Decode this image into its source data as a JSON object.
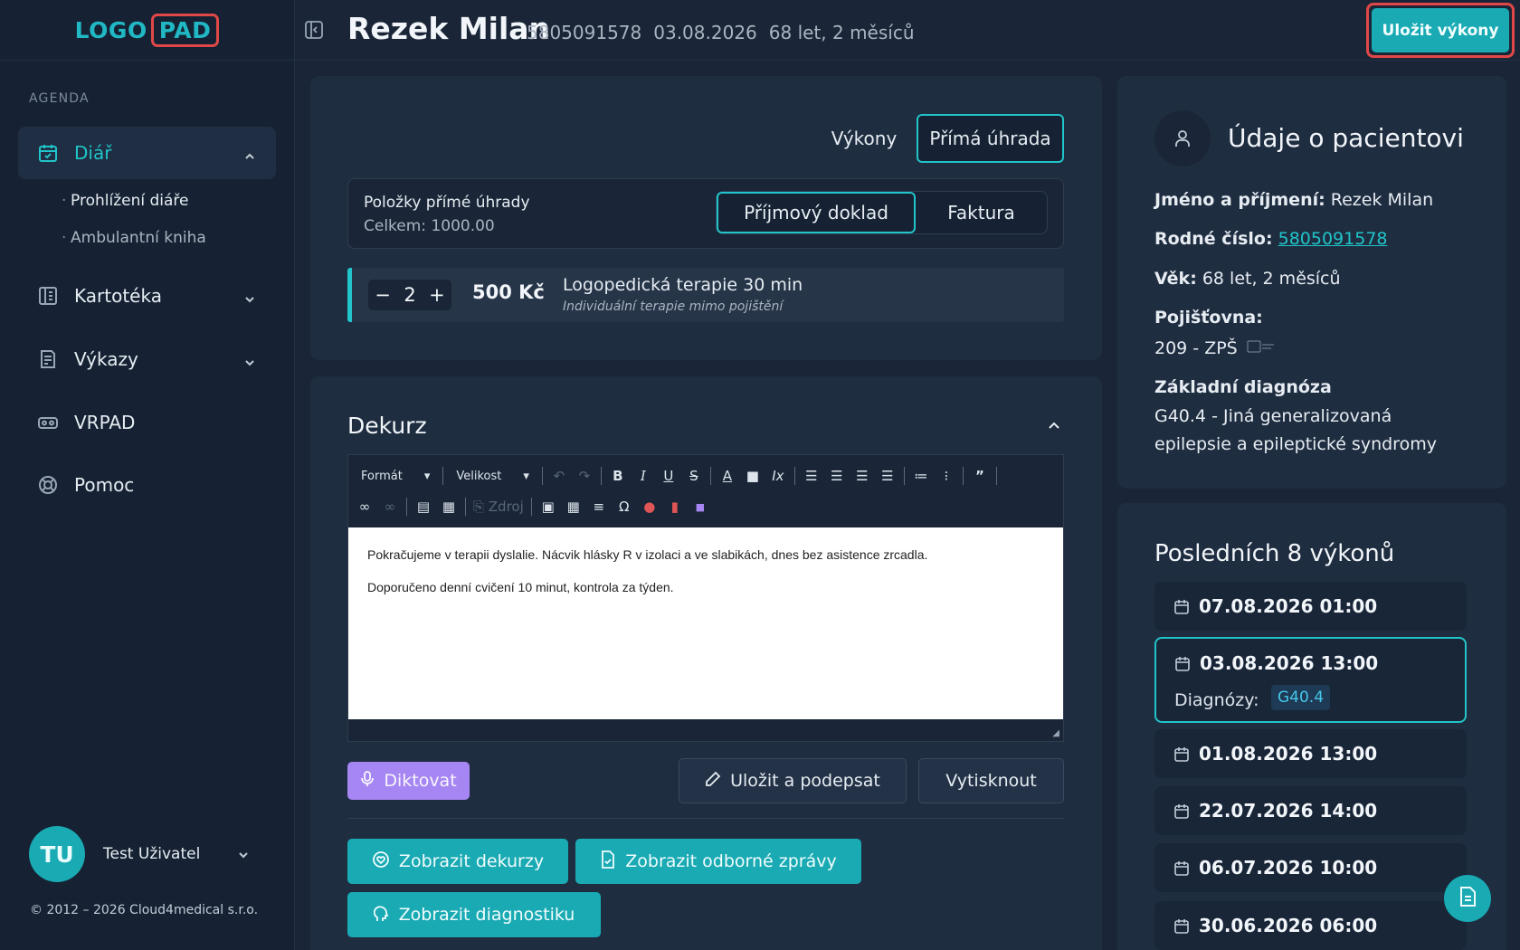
{
  "logo": {
    "part1": "LOGO",
    "part2": "PAD"
  },
  "sidebar": {
    "section_label": "AGENDA",
    "items": [
      {
        "label": "Diář",
        "icon": "calendar-icon",
        "active": true
      },
      {
        "label": "Kartotéka",
        "icon": "cards-icon"
      },
      {
        "label": "Výkazy",
        "icon": "report-icon"
      },
      {
        "label": "VRPAD",
        "icon": "vr-icon"
      },
      {
        "label": "Pomoc",
        "icon": "lifebuoy-icon"
      }
    ],
    "sub_items": [
      "Prohlížení diáře",
      "Ambulantní kniha"
    ],
    "user": {
      "initials": "TU",
      "name": "Test Uživatel"
    },
    "copyright": "© 2012 – 2026 Cloud4medical s.r.o."
  },
  "header": {
    "name": "Rezek Milan",
    "rc": "5805091578",
    "date": "03.08.2026",
    "age": "68 let, 2 měsíců",
    "save_label": "Uložit výkony"
  },
  "billing": {
    "tabs": [
      "Výkony",
      "Přímá úhrada"
    ],
    "selected_tab": "Přímá úhrada",
    "items_title": "Položky přímé úhrady",
    "items_total": "Celkem: 1000.00",
    "doc_types": [
      "Příjmový doklad",
      "Faktura"
    ],
    "selected_doc": "Příjmový doklad",
    "line": {
      "qty": "2",
      "minus": "−",
      "plus": "+",
      "price": "500 Kč",
      "name": "Logopedická terapie 30 min",
      "note": "Individuální terapie mimo pojištění"
    }
  },
  "dekurz": {
    "title": "Dekurz",
    "toolbar": {
      "format": "Formát",
      "size": "Velikost",
      "source": "Zdroj"
    },
    "text": [
      "Pokračujeme v terapii dyslalie. Nácvik hlásky R v izolaci a ve slabikách, dnes bez asistence zrcadla.",
      "Doporučeno denní cvičení 10 minut, kontrola za týden."
    ],
    "dictate_label": "Diktovat",
    "save_sign_label": "Uložit a podepsat",
    "print_label": "Vytisknout",
    "show_dekurzy": "Zobrazit dekurzy",
    "show_reports": "Zobrazit odborné zprávy",
    "show_diag": "Zobrazit diagnostiku"
  },
  "patient": {
    "title": "Údaje o pacientovi",
    "name_label": "Jméno a příjmení:",
    "name": "Rezek Milan",
    "rc_label": "Rodné číslo:",
    "rc": "5805091578",
    "age_label": "Věk:",
    "age": "68 let, 2 měsíců",
    "insurer_label": "Pojišťovna:",
    "insurer": "209 - ZPŠ",
    "diag_label": "Základní diagnóza",
    "diag_line1": "G40.4 - Jiná generalizovaná",
    "diag_line2": "epilepsie a epileptické syndromy"
  },
  "visits": {
    "title": "Posledních 8 výkonů",
    "items": [
      {
        "date": "07.08.2026 01:00"
      },
      {
        "date": "03.08.2026 13:00",
        "diag_label": "Diagnózy:",
        "diag": "G40.4",
        "selected": true
      },
      {
        "date": "01.08.2026 13:00"
      },
      {
        "date": "22.07.2026 14:00"
      },
      {
        "date": "06.07.2026 10:00"
      },
      {
        "date": "30.06.2026 06:00"
      }
    ]
  },
  "colors": {
    "accent": "#19aab3",
    "highlight": "#e04848",
    "purple": "#a586f2",
    "bg": "#1a2637"
  }
}
